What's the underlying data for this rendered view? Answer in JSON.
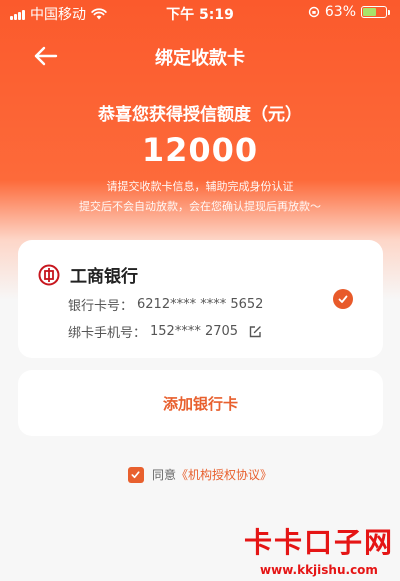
{
  "status_bar": {
    "carrier": "中国移动",
    "time": "下午 5:19",
    "battery_pct": "63%",
    "battery_level": 0.63
  },
  "nav": {
    "title": "绑定收款卡",
    "back_icon": "arrow-left-icon"
  },
  "hero": {
    "title": "恭喜您获得授信额度（元）",
    "amount": "12000",
    "line1": "请提交收款卡信息，辅助完成身份认证",
    "line2": "提交后不会自动放款，会在您确认提现后再放款～"
  },
  "bank_card": {
    "bank_name": "工商银行",
    "card_label": "银行卡号：",
    "card_number": "6212**** **** 5652",
    "phone_label": "绑卡手机号：",
    "phone": "152**** 2705",
    "selected": true
  },
  "add_card": {
    "label": "添加银行卡"
  },
  "agreement": {
    "prefix": "同意",
    "link": "《机构授权协议》",
    "checked": true
  },
  "watermark": {
    "title": "卡卡口子网",
    "url": "www.kkjishu.com"
  },
  "colors": {
    "header": "#fb5a2c",
    "accent": "#e8602e",
    "watermark": "#e51515"
  }
}
